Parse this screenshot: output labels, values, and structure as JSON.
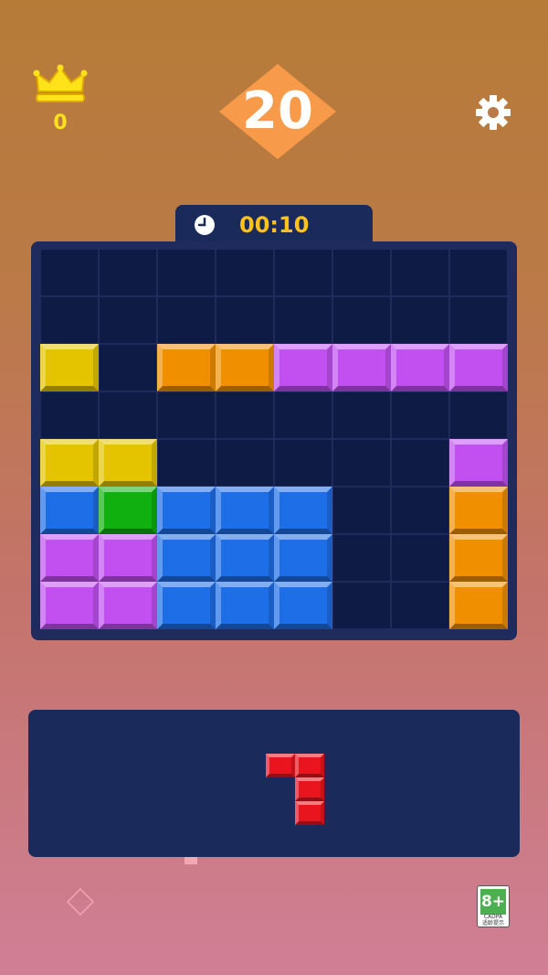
{
  "header": {
    "best_score": "0",
    "score": "20",
    "timer": "00:10",
    "icons": {
      "best": "crown-icon",
      "settings": "gear-icon",
      "timer": "clock-icon"
    }
  },
  "colors": {
    "empty_cell": "#0d1b45",
    "board_bg": "#1e2b5c",
    "score_diamond": "#f79a4a",
    "timer_text": "#ffc21a",
    "best_text": "#ffe21a",
    "Y": "#e4c400",
    "O": "#f09000",
    "P": "#c250f0",
    "B": "#1e6ee8",
    "G": "#10b010",
    "R": "#e8141e"
  },
  "board": {
    "rows": 8,
    "cols": 8,
    "grid": [
      "........",
      "........",
      "Y.OOPPPP",
      "........",
      "YY.....P",
      "BGBBB..O",
      "PPBBB..O",
      "PPBBB..O"
    ]
  },
  "tray": {
    "piece": {
      "color": "R",
      "shape": [
        "XX",
        ".X",
        ".X"
      ]
    }
  },
  "footer": {
    "hint_icon": "diamond-icon",
    "age_rating": {
      "label": "8+",
      "org": "CADPA",
      "note": "适龄提示"
    }
  }
}
